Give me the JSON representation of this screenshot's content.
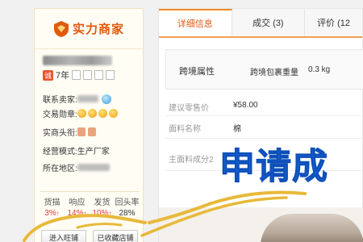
{
  "seller_panel": {
    "title": "实力商家",
    "years": "7年",
    "years_badge": "诚",
    "contact_label": "联系卖家:",
    "medal_label": "交易勋章:",
    "head_label": "实商头衔:",
    "mode_label": "经营模式:",
    "mode_value": "生产厂家",
    "region_label": "所在地区:",
    "stats": {
      "headers": [
        "货描",
        "响应",
        "发货",
        "回头率"
      ],
      "values": [
        "3%",
        "14%",
        "10%",
        "28%"
      ]
    },
    "buttons": {
      "enter_shop": "进入旺铺",
      "favorite_shop": "已收藏店铺"
    }
  },
  "tabs": [
    {
      "label": "详细信息"
    },
    {
      "label": "成交 (3)"
    },
    {
      "label": "评价 (12"
    }
  ],
  "cross_border": {
    "title": "跨境属性",
    "weight_label": "跨境包裹重量",
    "weight_value": "0.3 kg"
  },
  "attributes": {
    "price_label": "建议零售价",
    "price_value": "¥58.00",
    "fabric_label": "面料名称",
    "fabric_value": "棉",
    "composition_label": "主面料成分2"
  },
  "overlay_text": "申请成",
  "colors": {
    "accent_orange": "#e05a0e",
    "overlay_blue": "#1763d6",
    "scribble_yellow": "#e8b93a"
  }
}
